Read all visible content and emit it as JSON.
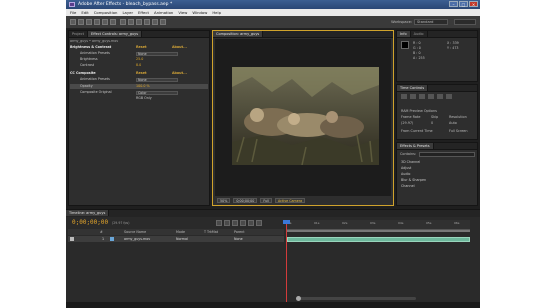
{
  "window": {
    "title": "Adobe After Effects - bleach_bypass.aep *",
    "buttons": [
      "–",
      "□",
      "×"
    ]
  },
  "menu": [
    "File",
    "Edit",
    "Composition",
    "Layer",
    "Effect",
    "Animation",
    "View",
    "Window",
    "Help"
  ],
  "workspace": {
    "label": "Workspace:",
    "value": "Standard"
  },
  "project_panel": {
    "tabs": [
      "Project",
      "Effect Controls: army_guys"
    ],
    "subtitle": "army_guys • army_guys.mov"
  },
  "effect_controls": {
    "rows": [
      {
        "name": "Brightness & Contrast",
        "reset": "Reset",
        "about": "About..."
      },
      {
        "name": "Animation Presets",
        "value": "None"
      },
      {
        "name": "Brightness",
        "value": "25.0"
      },
      {
        "name": "Contrast",
        "value": "8.0"
      },
      {
        "name": "CC Composite",
        "reset": "Reset",
        "about": "About..."
      },
      {
        "name": "Animation Presets",
        "value": "None"
      },
      {
        "name": "Opacity",
        "value": "100.0 %"
      },
      {
        "name": "Composite Original",
        "value": "Color"
      },
      {
        "name": "",
        "value": "RGB Only"
      }
    ]
  },
  "composition": {
    "tab": "Composition: army_guys",
    "zoom": "50%",
    "timecode": "0;00;00;00",
    "resolution": "Full",
    "camera": "Active Camera"
  },
  "info_panel": {
    "tabs": [
      "Info",
      "Audio"
    ],
    "lines_left": [
      "R : 0",
      "G : 0",
      "B : 0",
      "A : 255"
    ],
    "lines_right": [
      "X : 339",
      "Y : 473"
    ]
  },
  "time_controls": {
    "tab": "Time Controls",
    "ram_preview": "RAM Preview Options",
    "labels": [
      "Frame Rate",
      "Skip",
      "Resolution"
    ],
    "values": [
      "(29.97)",
      "0",
      "Auto"
    ],
    "options": [
      "From Current Time",
      "Full Screen"
    ]
  },
  "effects_presets": {
    "tab": "Effects & Presets",
    "search": "Contains:",
    "items": [
      "3D Channel",
      "Adjust",
      "Audio",
      "Blur & Sharpen",
      "Channel"
    ]
  },
  "timeline": {
    "tab": "Timeline: army_guys",
    "timecode": "0;00;00;00",
    "fps": "(29.97 fps)",
    "columns": [
      "#",
      "Source Name",
      "Mode",
      "T TrkMat",
      "Parent"
    ],
    "layer": {
      "index": "1",
      "name": "army_guys.mov",
      "mode": "Normal",
      "parent": "None"
    },
    "ruler_ticks": [
      "00s",
      "01s",
      "02s",
      "03s",
      "04s",
      "05s",
      "06s"
    ]
  }
}
